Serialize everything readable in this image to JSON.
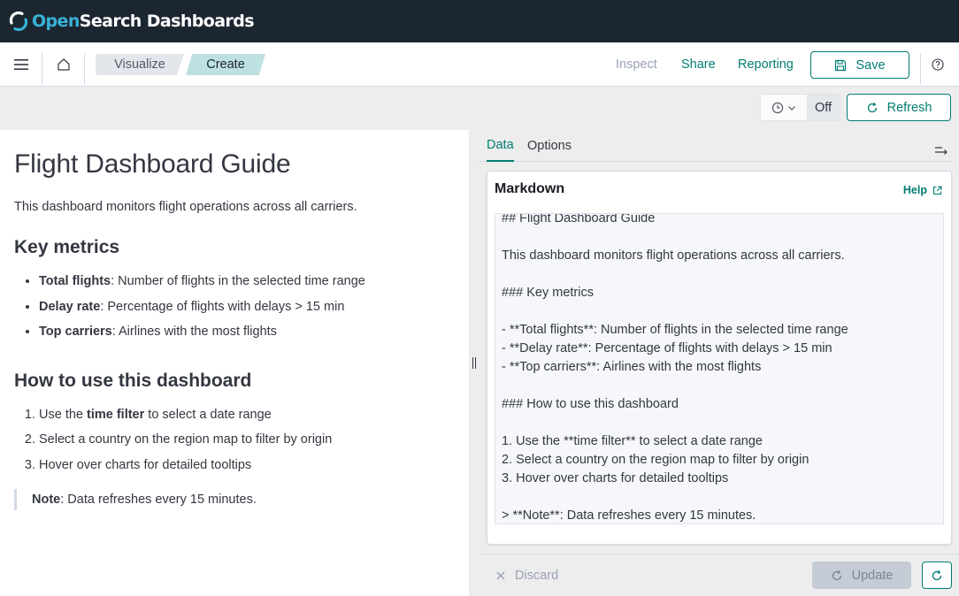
{
  "header": {
    "logo_open": "Open",
    "logo_rest": "Search Dashboards"
  },
  "nav": {
    "menu_icon": "hamburger-icon",
    "home_icon": "home-icon",
    "breadcrumbs": [
      {
        "label": "Visualize"
      },
      {
        "label": "Create"
      }
    ],
    "inspect_label": "Inspect",
    "share_label": "Share",
    "reporting_label": "Reporting",
    "save_label": "Save",
    "help_icon": "help-icon"
  },
  "refresh": {
    "interval_label": "Off",
    "refresh_label": "Refresh"
  },
  "preview": {
    "title": "Flight Dashboard Guide",
    "intro": "This dashboard monitors flight operations across all carriers.",
    "key_metrics_heading": "Key metrics",
    "metrics": [
      {
        "term": "Total flights",
        "desc": ": Number of flights in the selected time range"
      },
      {
        "term": "Delay rate",
        "desc": ": Percentage of flights with delays > 15 min"
      },
      {
        "term": "Top carriers",
        "desc": ": Airlines with the most flights"
      }
    ],
    "how_heading": "How to use this dashboard",
    "steps": [
      {
        "pre": "Use the ",
        "bold": "time filter",
        "post": " to select a date range"
      },
      {
        "pre": "Select a country on the region map to filter by origin",
        "bold": "",
        "post": ""
      },
      {
        "pre": "Hover over charts for detailed tooltips",
        "bold": "",
        "post": ""
      }
    ],
    "note_bold": "Note",
    "note_text": ": Data refreshes every 15 minutes."
  },
  "editor": {
    "tabs": [
      {
        "label": "Data",
        "active": true
      },
      {
        "label": "Options",
        "active": false
      }
    ],
    "panel_title": "Markdown",
    "help_label": "Help",
    "markdown_lines": [
      "## Flight Dashboard Guide",
      "",
      "This dashboard monitors flight operations across all carriers.",
      "",
      "### Key metrics",
      "",
      "- **Total flights**: Number of flights in the selected time range",
      "- **Delay rate**: Percentage of flights with delays > 15 min",
      "- **Top carriers**: Airlines with the most flights",
      "",
      "### How to use this dashboard",
      "",
      "1. Use the **time filter** to select a date range",
      "2. Select a country on the region map to filter by origin",
      "3. Hover over charts for detailed tooltips",
      "",
      "> **Note**: Data refreshes every 15 minutes."
    ],
    "discard_label": "Discard",
    "update_label": "Update"
  },
  "colors": {
    "accent": "#017d73",
    "header_bg": "#1c2631",
    "logo_blue": "#38b2d6"
  }
}
